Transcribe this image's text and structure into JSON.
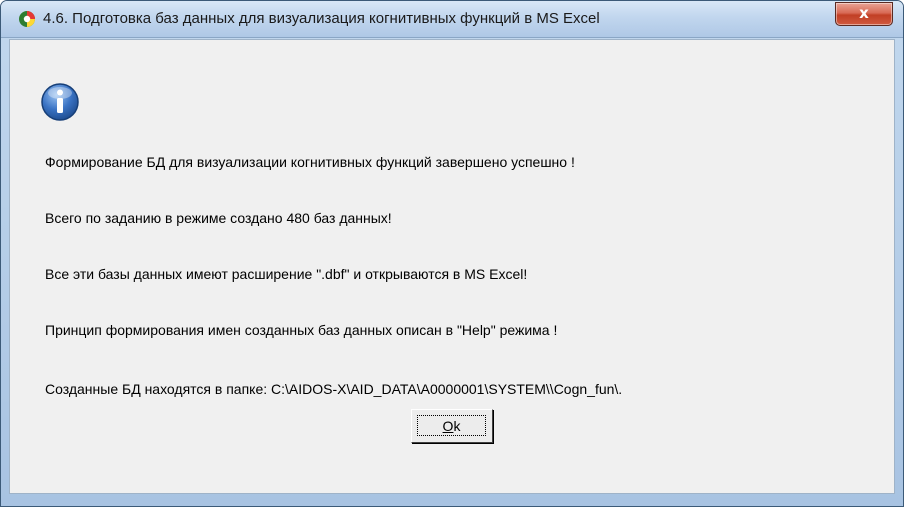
{
  "window": {
    "title": "4.6. Подготовка баз данных для визуализация когнитивных функций в MS Excel",
    "close_glyph": "x",
    "app_icon": "aidos-swirl-icon"
  },
  "dialog": {
    "icon": "info-icon",
    "messages": [
      "Формирование БД для визуализации когнитивных функций завершено успешно !",
      "Всего по заданию в режиме создано 480 баз данных!",
      "Все эти базы данных имеют расширение \".dbf\" и открываются в MS Excel!",
      "Принцип формирования имен созданных баз данных описан в \"Help\" режима !",
      "Созданные БД находятся в папке: C:\\AIDOS-X\\AID_DATA\\A0000001\\SYSTEM\\\\Cogn_fun\\."
    ],
    "ok_mnemonic": "O",
    "ok_rest": "k"
  },
  "colors": {
    "titlebar": "#c1d6ee",
    "client_bg": "#f0f0f0",
    "close_button": "#c13f25",
    "info_blue": "#2d5ea8"
  }
}
